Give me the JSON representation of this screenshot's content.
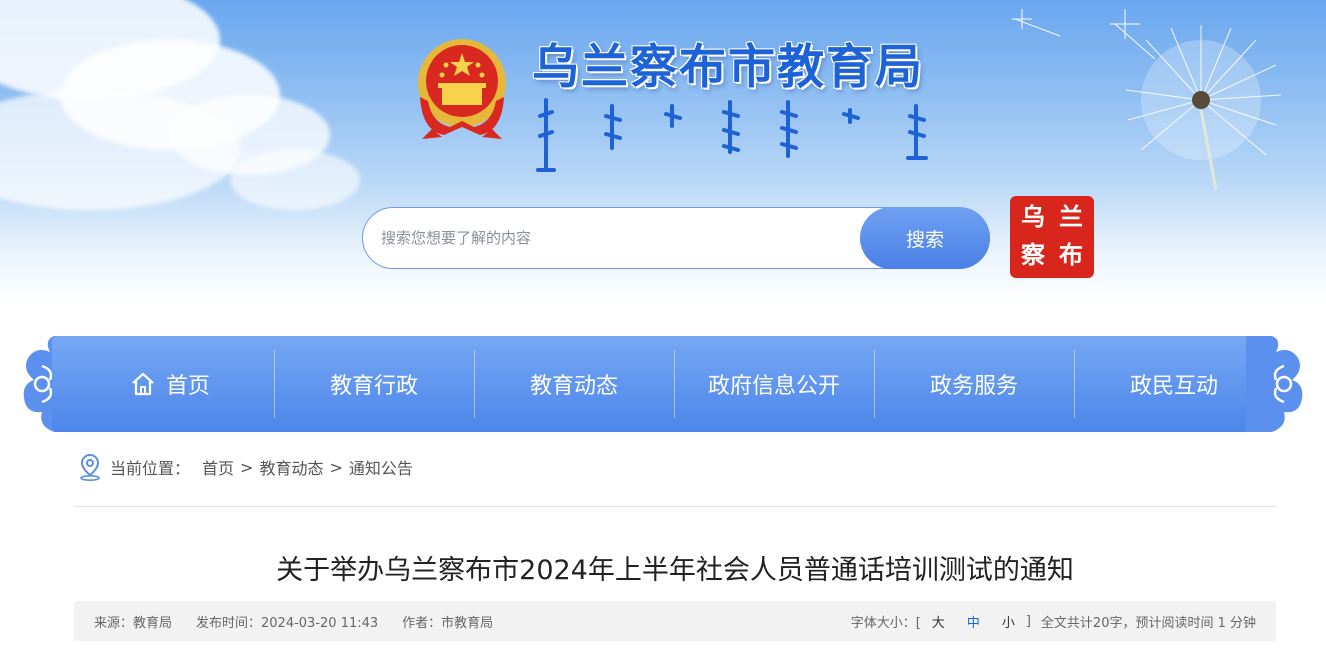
{
  "header": {
    "site_title": "乌兰察布市教育局",
    "search_placeholder": "搜索您想要了解的内容",
    "search_button": "搜索",
    "seal_chars": [
      "乌",
      "兰",
      "察",
      "布"
    ]
  },
  "nav": {
    "items": [
      {
        "label": "首页",
        "icon": "home-icon"
      },
      {
        "label": "教育行政"
      },
      {
        "label": "教育动态"
      },
      {
        "label": "政府信息公开"
      },
      {
        "label": "政务服务"
      },
      {
        "label": "政民互动"
      }
    ]
  },
  "breadcrumb": {
    "prefix": "当前位置：",
    "items": [
      "首页",
      "教育动态",
      "通知公告"
    ],
    "separator": ">"
  },
  "article": {
    "title": "关于举办乌兰察布市2024年上半年社会人员普通话培训测试的通知",
    "source": "来源：教育局",
    "publish_time": "发布时间：2024-03-20 11:43",
    "author": "作者：市教育局",
    "font_size_label": "字体大小：[",
    "font_sizes": [
      "大",
      "中",
      "小"
    ],
    "font_size_close": "]",
    "read_info": "全文共计20字，预计阅读时间 1 分钟"
  },
  "colors": {
    "title_blue": "#1d62d6",
    "nav_blue": "#4d85ea",
    "seal_red": "#d9261c"
  }
}
